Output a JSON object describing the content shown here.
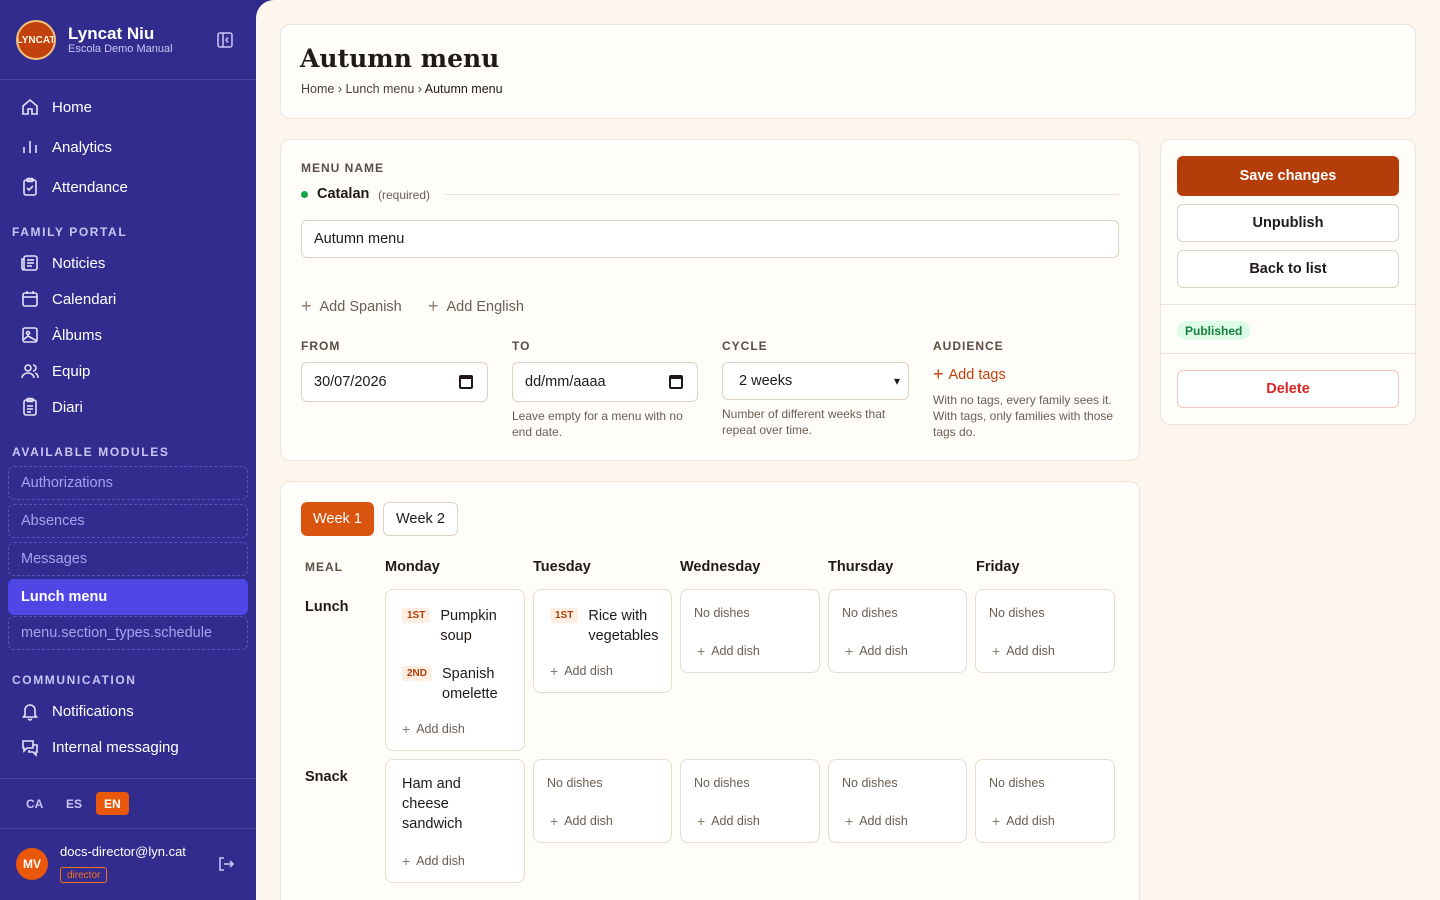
{
  "brand": {
    "name": "Lyncat Niu",
    "subtitle": "Escola Demo Manual",
    "logo_text": "LYNCAT"
  },
  "sidebar": {
    "items": [
      {
        "label": "Home"
      },
      {
        "label": "Analytics"
      },
      {
        "label": "Attendance"
      }
    ],
    "family_portal_title": "FAMILY PORTAL",
    "family_portal": [
      {
        "label": "Noticies"
      },
      {
        "label": "Calendari"
      },
      {
        "label": "Àlbums"
      },
      {
        "label": "Equip"
      },
      {
        "label": "Diari"
      }
    ],
    "modules_title": "AVAILABLE MODULES",
    "modules": [
      {
        "label": "Authorizations"
      },
      {
        "label": "Absences"
      },
      {
        "label": "Messages"
      },
      {
        "label": "Lunch menu"
      },
      {
        "label": "menu.section_types.schedule"
      }
    ],
    "communication_title": "COMMUNICATION",
    "communication": [
      {
        "label": "Notifications"
      },
      {
        "label": "Internal messaging"
      }
    ]
  },
  "languages": [
    "CA",
    "ES",
    "EN"
  ],
  "user": {
    "initials": "MV",
    "email": "docs-director@lyn.cat",
    "role": "director"
  },
  "header": {
    "title": "Autumn menu",
    "breadcrumb": {
      "home": "Home",
      "sep": "›",
      "parent": "Lunch menu",
      "current": "Autumn menu"
    }
  },
  "form": {
    "menu_name_label": "MENU NAME",
    "language": "Catalan",
    "required": "(required)",
    "name_value": "Autumn menu",
    "add_spanish": "Add Spanish",
    "add_english": "Add English",
    "from_label": "FROM",
    "from_value": "30/07/2026",
    "to_label": "TO",
    "to_placeholder": "dd/mm/aaaa",
    "to_help": "Leave empty for a menu with no end date.",
    "cycle_label": "CYCLE",
    "cycle_value": "2 weeks",
    "cycle_help": "Number of different weeks that repeat over time.",
    "audience_label": "AUDIENCE",
    "add_tags": "Add tags",
    "audience_help": "With no tags, every family sees it. With tags, only families with those tags do."
  },
  "actions": {
    "save": "Save changes",
    "unpublish": "Unpublish",
    "back": "Back to list",
    "status": "Published",
    "delete": "Delete"
  },
  "schedule": {
    "tabs": [
      "Week 1",
      "Week 2"
    ],
    "meal_header": "MEAL",
    "days": [
      "Monday",
      "Tuesday",
      "Wednesday",
      "Thursday",
      "Friday"
    ],
    "no_dishes": "No dishes",
    "add_dish": "Add dish",
    "lunch": {
      "label": "Lunch",
      "monday": [
        {
          "course": "1ST",
          "name_1": "Pumpkin",
          "name_2": "soup"
        },
        {
          "course": "2ND",
          "name_1": "Spanish",
          "name_2": "omelette"
        }
      ],
      "tuesday": [
        {
          "course": "1ST",
          "name_1": "Rice with",
          "name_2": "vegetables"
        }
      ]
    },
    "snack": {
      "label": "Snack",
      "monday": [
        {
          "name_1": "Ham and",
          "name_2": "cheese",
          "name_3": "sandwich"
        }
      ]
    }
  }
}
